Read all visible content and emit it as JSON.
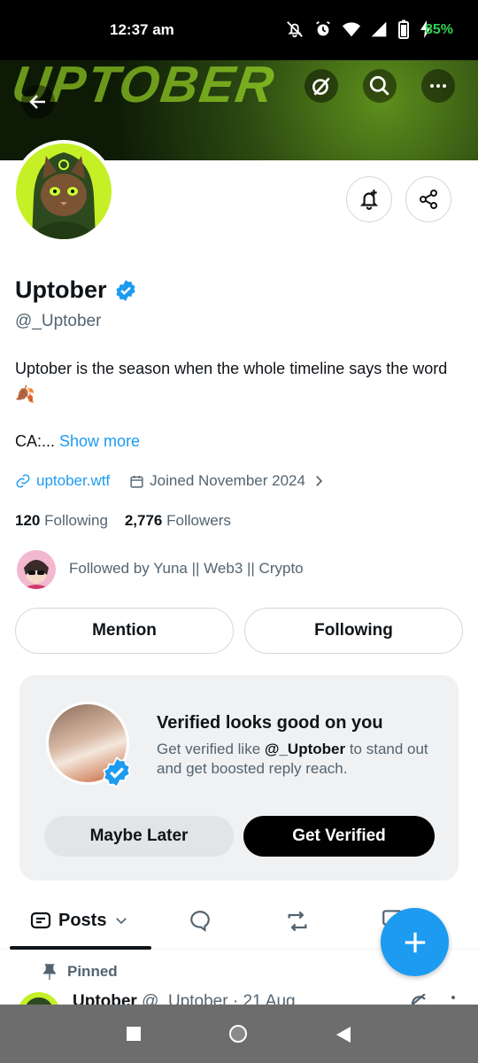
{
  "status": {
    "time": "12:37 am",
    "battery": "85%"
  },
  "profile": {
    "name": "Uptober",
    "handle": "@_Uptober",
    "bio_line1": "Uptober is the season when the whole timeline says the word",
    "bio_emoji": "🍂",
    "ca_text": "CA:...",
    "show_more": "Show more",
    "website": "uptober.wtf",
    "joined": "Joined November 2024",
    "following_count": "120",
    "following_label": "Following",
    "followers_count": "2,776",
    "followers_label": "Followers",
    "followed_by": "Followed by Yuna || Web3 || Crypto"
  },
  "actions": {
    "mention": "Mention",
    "following": "Following"
  },
  "promo": {
    "title": "Verified looks good on you",
    "desc_prefix": "Get verified like ",
    "desc_handle": "@_Uptober",
    "desc_suffix": " to stand out and get boosted reply reach.",
    "maybe_later": "Maybe Later",
    "get_verified": "Get Verified"
  },
  "tabs": {
    "posts": "Posts"
  },
  "pinned": {
    "label": "Pinned",
    "author": "Uptober",
    "handle_date": "@_Uptober · 21 Aug"
  },
  "colors": {
    "accent": "#1d9bf0",
    "text": "#0f1419",
    "muted": "#536471",
    "lime": "#c5f026"
  }
}
